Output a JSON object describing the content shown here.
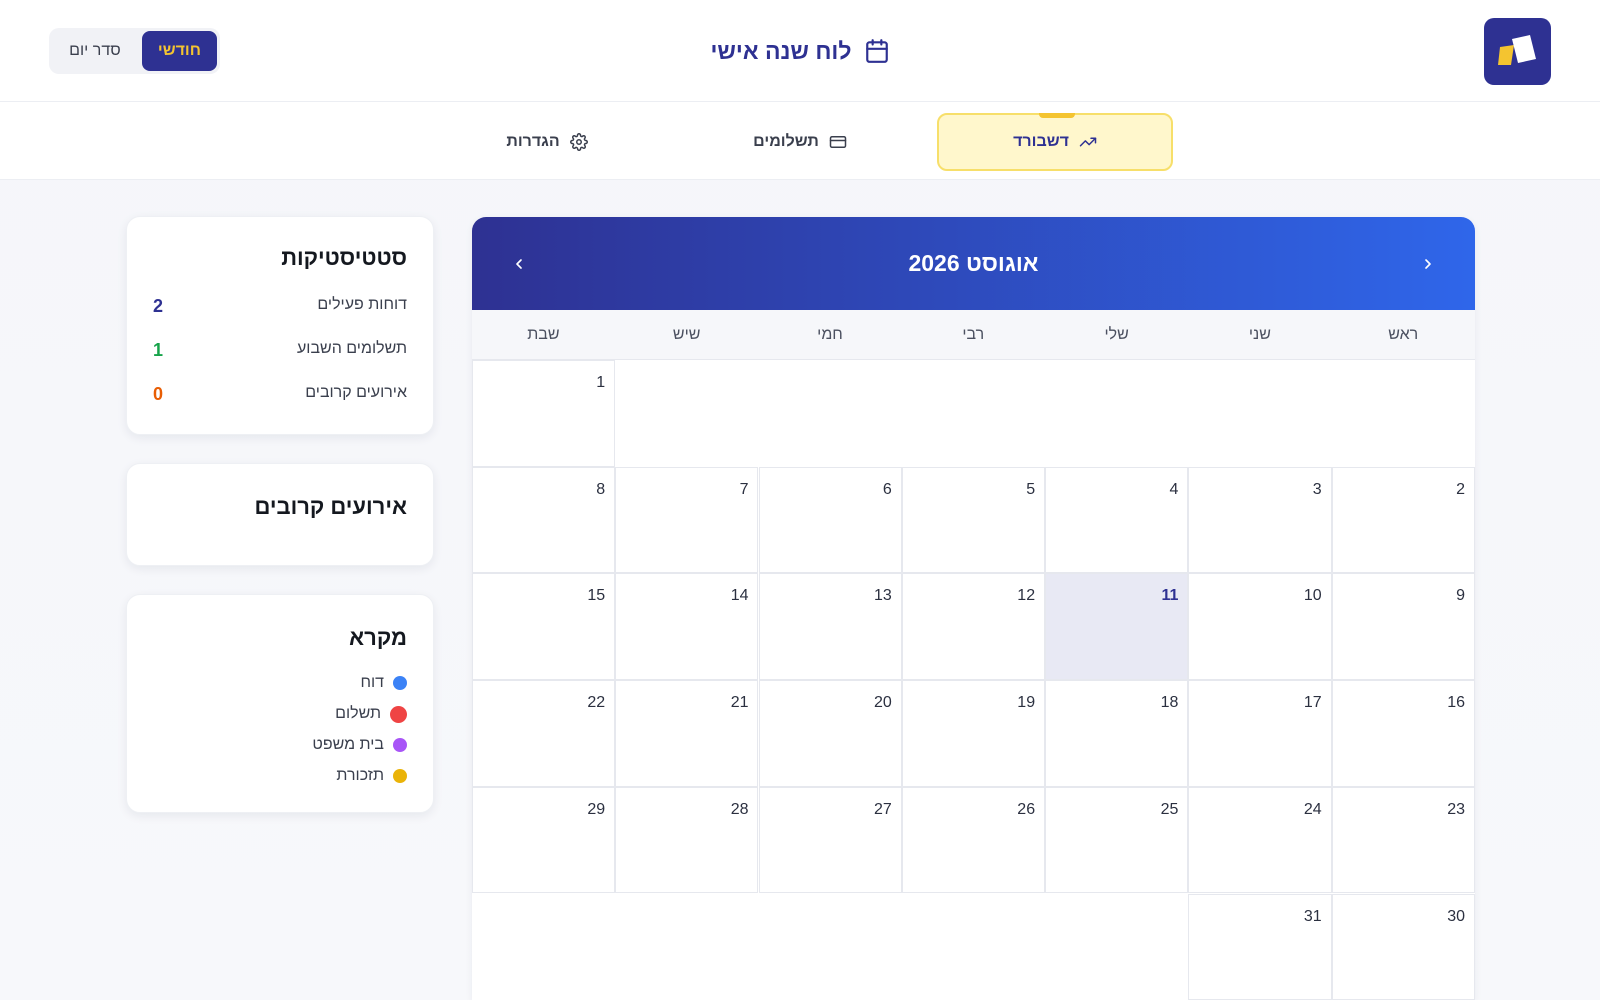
{
  "header": {
    "app_title": "לוח שנה אישי",
    "logo_icon": "brand-logo",
    "view_toggle": {
      "day_label": "סדר יום",
      "month_label": "חודשי",
      "selected": "חודשי"
    }
  },
  "tabs": [
    {
      "label": "דשבורד",
      "icon": "trending-up-icon",
      "active": true
    },
    {
      "label": "תשלומים",
      "icon": "credit-card-icon",
      "active": false
    },
    {
      "label": "הגדרות",
      "icon": "gear-icon",
      "active": false
    }
  ],
  "calendar": {
    "month_title": "אוגוסט 2026",
    "weekdays": [
      "ראש",
      "שני",
      "שלי",
      "רבי",
      "חמי",
      "שיש",
      "שבת"
    ],
    "today": "11",
    "weeks": [
      [
        "",
        "",
        "",
        "",
        "",
        "",
        "1"
      ],
      [
        "2",
        "3",
        "4",
        "5",
        "6",
        "7",
        "8"
      ],
      [
        "9",
        "10",
        "11",
        "12",
        "13",
        "14",
        "15"
      ],
      [
        "16",
        "17",
        "18",
        "19",
        "20",
        "21",
        "22"
      ],
      [
        "23",
        "24",
        "25",
        "26",
        "27",
        "28",
        "29"
      ],
      [
        "30",
        "31",
        "",
        "",
        "",
        "",
        ""
      ]
    ]
  },
  "stats": {
    "title": "סטטיסטיקות",
    "items": [
      {
        "label": "דוחות פעילים",
        "value": "2",
        "color": "#2e3192"
      },
      {
        "label": "תשלומים השבוע",
        "value": "1",
        "color": "#16a34a"
      },
      {
        "label": "אירועים קרובים",
        "value": "0",
        "color": "#e85d04"
      }
    ]
  },
  "upcoming": {
    "title": "אירועים קרובים"
  },
  "legend": {
    "title": "מקרא",
    "items": [
      {
        "label": "דוח",
        "color": "#3b82f6"
      },
      {
        "label": "תשלום",
        "color": "#ef4444"
      },
      {
        "label": "בית משפט",
        "color": "#a855f7"
      },
      {
        "label": "תזכורת",
        "color": "#eab308"
      }
    ]
  }
}
